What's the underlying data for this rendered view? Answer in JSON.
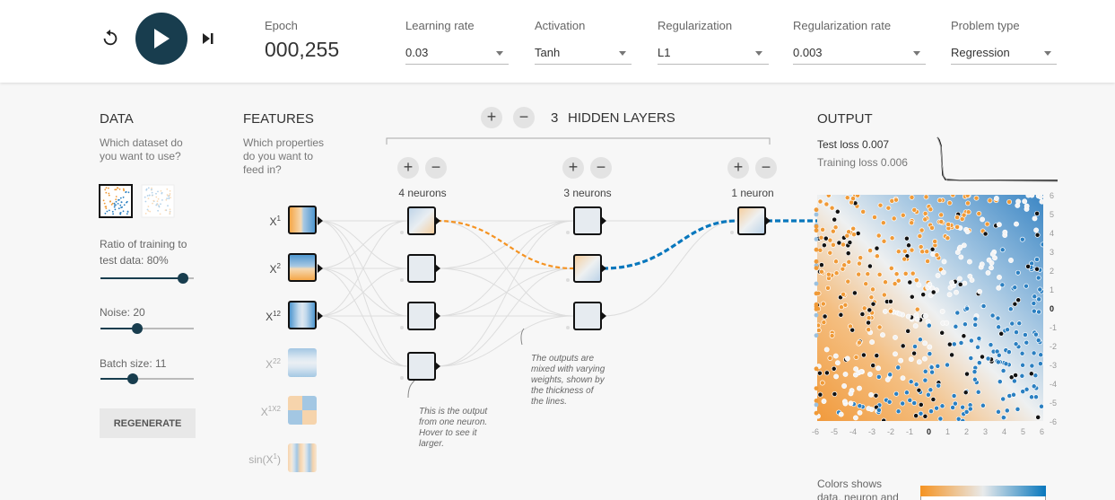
{
  "topbar": {
    "epoch_label": "Epoch",
    "epoch_value": "000,255",
    "learning_rate_label": "Learning rate",
    "learning_rate_value": "0.03",
    "activation_label": "Activation",
    "activation_value": "Tanh",
    "regularization_label": "Regularization",
    "regularization_value": "L1",
    "reg_rate_label": "Regularization rate",
    "reg_rate_value": "0.003",
    "problem_type_label": "Problem type",
    "problem_type_value": "Regression"
  },
  "data_panel": {
    "title": "DATA",
    "question": [
      "Which dataset do",
      "you want to use?"
    ],
    "ratio_label": [
      "Ratio of training to",
      "test data:  80%"
    ],
    "ratio_value": 80,
    "noise_label": "Noise:  20",
    "noise_value": 20,
    "batch_label": "Batch size:  11",
    "batch_value": 11,
    "regenerate_label": "REGENERATE"
  },
  "features_panel": {
    "title": "FEATURES",
    "question": [
      "Which properties",
      "do you want to",
      "feed in?"
    ],
    "features": [
      {
        "main": "X",
        "sup": "1",
        "active": true
      },
      {
        "main": "X",
        "sup": "2",
        "active": true
      },
      {
        "main": "X",
        "sup": "12",
        "active": true
      },
      {
        "main": "X",
        "sup": "22",
        "active": false
      },
      {
        "main": "X",
        "sup": "1X2",
        "active": false
      },
      {
        "main": "sin(X",
        "sup": "1",
        "tail": ")",
        "active": false
      }
    ]
  },
  "network": {
    "hidden_layers_label": "HIDDEN LAYERS",
    "hidden_layers_count": "3",
    "plus": "+",
    "minus": "−",
    "layers": [
      {
        "neurons_label": "4 neurons"
      },
      {
        "neurons_label": "3 neurons"
      },
      {
        "neurons_label": "1 neuron"
      }
    ],
    "annot_output": [
      "This is the output",
      "from one neuron.",
      "Hover to see it",
      "larger."
    ],
    "annot_weights": [
      "The outputs are",
      "mixed with varying",
      "weights, shown by",
      "the thickness of",
      "the lines."
    ]
  },
  "output_panel": {
    "title": "OUTPUT",
    "test_loss_label": "Test loss ",
    "test_loss_value": "0.007",
    "training_loss_label": "Training loss ",
    "training_loss_value": "0.006",
    "x_ticks": [
      "-6",
      "-5",
      "-4",
      "-3",
      "-2",
      "-1",
      "0",
      "1",
      "2",
      "3",
      "4",
      "5",
      "6"
    ],
    "y_ticks": [
      "6",
      "5",
      "4",
      "3",
      "2",
      "1",
      "0",
      "-1",
      "-2",
      "-3",
      "-4",
      "-5",
      "-6"
    ],
    "colors_caption": [
      "Colors shows",
      "data, neuron and"
    ]
  },
  "colors": {
    "accent": "#183d4e",
    "orange": "#f59322",
    "blue": "#0877bd"
  }
}
